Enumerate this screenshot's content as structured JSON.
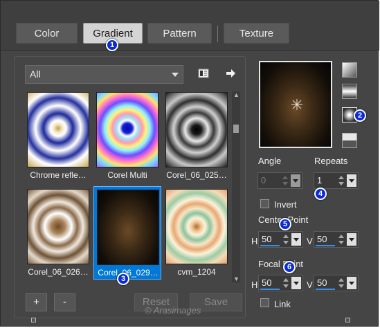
{
  "tabs": [
    {
      "label": "Color",
      "active": false
    },
    {
      "label": "Gradient",
      "active": true
    },
    {
      "label": "Pattern",
      "active": false
    },
    {
      "label": "Texture",
      "active": false
    }
  ],
  "category": {
    "selected": "All"
  },
  "gallery": [
    {
      "caption": "Chrome refle…"
    },
    {
      "caption": "Corel Multi"
    },
    {
      "caption": "Corel_06_025…"
    },
    {
      "caption": "Corel_06_026…"
    },
    {
      "caption": "Corel_06_029…",
      "selected": true
    },
    {
      "caption": "cvm_1204"
    }
  ],
  "buttons": {
    "add": "+",
    "remove": "-",
    "reset": "Reset",
    "save": "Save"
  },
  "icons": {
    "library": "library-icon",
    "export": "arrow-right-icon"
  },
  "angle": {
    "label": "Angle",
    "value": "0"
  },
  "repeats": {
    "label": "Repeats",
    "value": "1"
  },
  "invert": {
    "label": "Invert",
    "checked": false
  },
  "center_point": {
    "label": "Center Point",
    "h_label": "H",
    "h_value": "50",
    "v_label": "V",
    "v_value": "50"
  },
  "focal_point": {
    "label": "Focal Point",
    "h_label": "H",
    "h_value": "50",
    "v_label": "V",
    "v_value": "50"
  },
  "link": {
    "label": "Link",
    "checked": false
  },
  "badges": [
    "1",
    "2",
    "3",
    "4",
    "5",
    "6"
  ],
  "watermark": "© Arasimages",
  "colors": {
    "accent": "#0078d7",
    "badge": "#0a2bd8",
    "panel": "#454545"
  }
}
